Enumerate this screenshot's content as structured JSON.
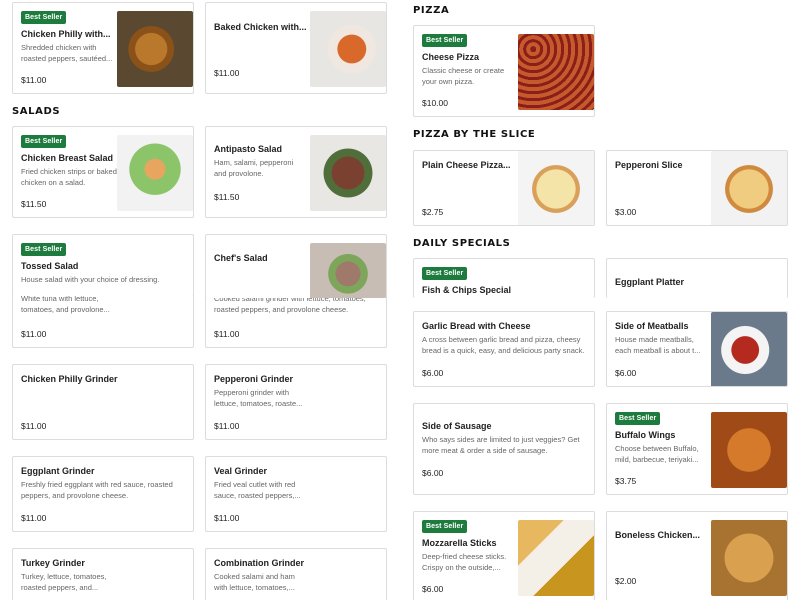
{
  "badge_text": "Best Seller",
  "brand_color": "#1e7b3e",
  "headings": {
    "salads": "SALADS",
    "pizza": "PIZZA",
    "pizza_slice": "PIZZA BY THE SLICE",
    "daily_specials": "DAILY SPECIALS"
  },
  "items": {
    "chicken_philly_with": {
      "title": "Chicken Philly with...",
      "desc": "Shredded chicken with roasted peppers, sautéed...",
      "price": "$11.00"
    },
    "baked_chicken": {
      "title": "Baked Chicken with...",
      "price": "$11.00"
    },
    "cheese_pizza": {
      "title": "Cheese Pizza",
      "desc": "Classic cheese or create your own pizza.",
      "price": "$10.00"
    },
    "chicken_breast_salad": {
      "title": "Chicken Breast Salad",
      "desc": "Fried chicken strips or baked chicken on a salad.",
      "price": "$11.50"
    },
    "antipasto_salad": {
      "title": "Antipasto Salad",
      "desc": "Ham, salami, pepperoni and provolone.",
      "price": "$11.50"
    },
    "plain_cheese_slice": {
      "title": "Plain Cheese Pizza...",
      "price": "$2.75"
    },
    "pepperoni_slice": {
      "title": "Pepperoni Slice",
      "price": "$3.00"
    },
    "tossed_salad": {
      "title": "Tossed Salad",
      "desc": "House salad with your choice of dressing.",
      "price": "$11.00",
      "peek": "White tuna with lettuce, tomatoes, and provolone..."
    },
    "chefs_salad": {
      "title": "Chef's Salad",
      "price": "$11.00",
      "peek": "Cooked salami grinder with lettuce, tomatoes, roasted peppers, and provolone cheese."
    },
    "fish_chips": {
      "title": "Fish & Chips Special"
    },
    "eggplant_platter": {
      "title": "Eggplant Platter"
    },
    "garlic_bread": {
      "title": "Garlic Bread with Cheese",
      "desc": "A cross between garlic bread and pizza, cheesy bread is a quick, easy, and delicious party snack.",
      "price": "$6.00"
    },
    "side_meatballs": {
      "title": "Side of Meatballs",
      "desc": "House made meatballs, each meatball is about t...",
      "price": "$6.00"
    },
    "chicken_philly_grinder": {
      "title": "Chicken Philly Grinder",
      "price": "$11.00"
    },
    "pepperoni_grinder": {
      "title": "Pepperoni Grinder",
      "desc": "Pepperoni grinder with lettuce, tomatoes, roaste...",
      "price": "$11.00"
    },
    "side_sausage": {
      "title": "Side of Sausage",
      "desc": "Who says sides are limited to just veggies? Get more meat & order a side of sausage.",
      "price": "$6.00"
    },
    "buffalo_wings": {
      "title": "Buffalo Wings",
      "desc": "Choose between Buffalo, mild, barbecue, teriyaki...",
      "price": "$3.75"
    },
    "eggplant_grinder": {
      "title": "Eggplant Grinder",
      "desc": "Freshly fried eggplant with red sauce, roasted peppers, and provolone cheese.",
      "price": "$11.00"
    },
    "veal_grinder": {
      "title": "Veal Grinder",
      "desc": "Fried veal cutlet with red sauce, roasted peppers,...",
      "price": "$11.00"
    },
    "mozzarella_sticks": {
      "title": "Mozzarella Sticks",
      "desc": "Deep-fried cheese sticks. Crispy on the outside,...",
      "price": "$6.00"
    },
    "boneless_chicken": {
      "title": "Boneless Chicken...",
      "price": "$2.00"
    },
    "turkey_grinder": {
      "title": "Turkey Grinder",
      "desc": "Turkey, lettuce, tomatoes, roasted peppers, and..."
    },
    "combination_grinder": {
      "title": "Combination Grinder",
      "desc": "Cooked salami and ham with lettuce, tomatoes,..."
    }
  }
}
